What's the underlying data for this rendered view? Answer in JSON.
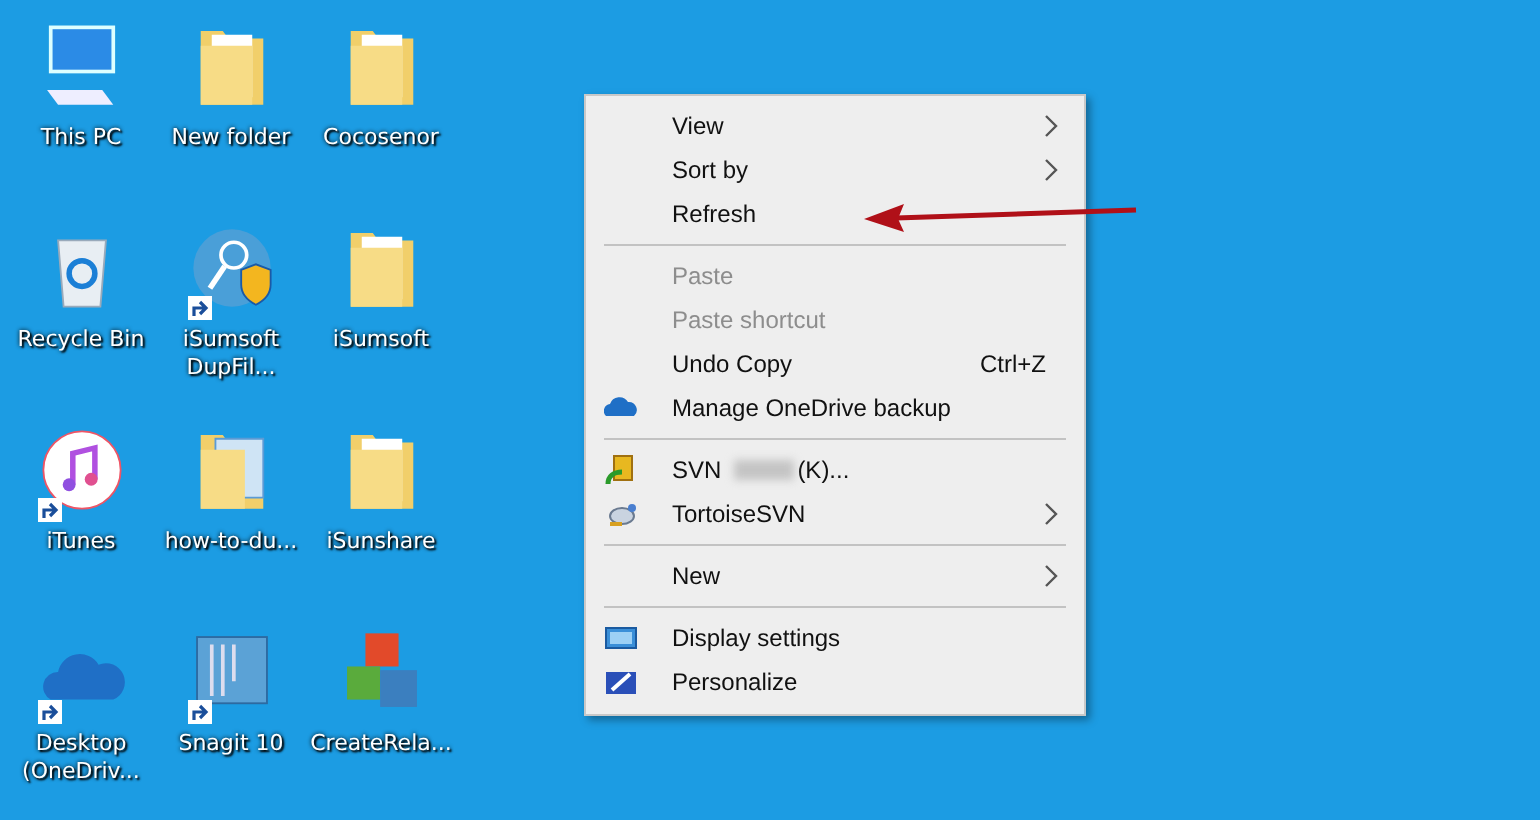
{
  "desktop_icons": [
    {
      "label": "This PC",
      "shortcut": false
    },
    {
      "label": "New folder",
      "shortcut": false
    },
    {
      "label": "Cocosenor",
      "shortcut": false
    },
    {
      "label": "Recycle Bin",
      "shortcut": false
    },
    {
      "label": "iSumsoft DupFil...",
      "shortcut": true
    },
    {
      "label": "iSumsoft",
      "shortcut": false
    },
    {
      "label": "iTunes",
      "shortcut": true
    },
    {
      "label": "how-to-du...",
      "shortcut": false
    },
    {
      "label": "iSunshare",
      "shortcut": false
    },
    {
      "label": "Desktop (OneDriv...",
      "shortcut": true
    },
    {
      "label": "Snagit 10",
      "shortcut": true
    },
    {
      "label": "CreateRela...",
      "shortcut": false
    }
  ],
  "context_menu": {
    "items": [
      {
        "kind": "item",
        "label": "View",
        "submenu": true,
        "disabled": false
      },
      {
        "kind": "item",
        "label": "Sort by",
        "submenu": true,
        "disabled": false
      },
      {
        "kind": "item",
        "label": "Refresh",
        "submenu": false,
        "disabled": false
      },
      {
        "kind": "separator"
      },
      {
        "kind": "item",
        "label": "Paste",
        "submenu": false,
        "disabled": true
      },
      {
        "kind": "item",
        "label": "Paste shortcut",
        "submenu": false,
        "disabled": true
      },
      {
        "kind": "item",
        "label": "Undo Copy",
        "shortcut": "Ctrl+Z",
        "submenu": false,
        "disabled": false
      },
      {
        "kind": "item",
        "label": "Manage OneDrive backup",
        "submenu": false,
        "disabled": false
      },
      {
        "kind": "separator"
      },
      {
        "kind": "item",
        "label": "SVN",
        "redacted": true,
        "label_suffix": "(K)...",
        "submenu": false,
        "disabled": false
      },
      {
        "kind": "item",
        "label": "TortoiseSVN",
        "submenu": true,
        "disabled": false
      },
      {
        "kind": "separator"
      },
      {
        "kind": "item",
        "label": "New",
        "submenu": true,
        "disabled": false
      },
      {
        "kind": "separator"
      },
      {
        "kind": "item",
        "label": "Display settings",
        "submenu": false,
        "disabled": false
      },
      {
        "kind": "item",
        "label": "Personalize",
        "submenu": false,
        "disabled": false
      }
    ]
  }
}
